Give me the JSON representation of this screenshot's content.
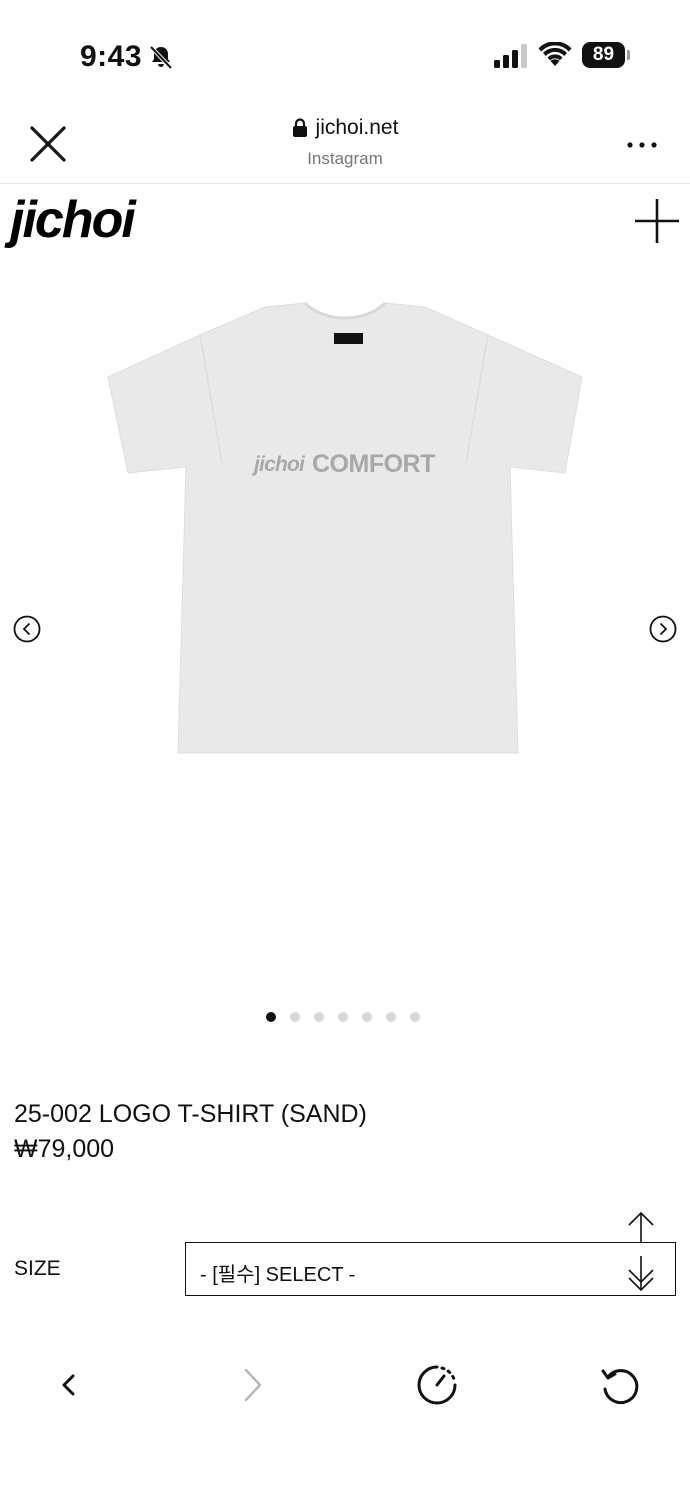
{
  "status_bar": {
    "time": "9:43",
    "battery": "89",
    "icons": [
      "bell-slash-icon",
      "cellular-signal-icon",
      "wifi-icon",
      "battery-icon"
    ]
  },
  "browser": {
    "url": "jichoi.net",
    "subtitle": "Instagram",
    "icons": [
      "close-icon",
      "lock-icon",
      "more-icon"
    ]
  },
  "site": {
    "logo": "jichoi",
    "menu_icon": "plus-icon"
  },
  "product": {
    "image_print_brand": "jichoi",
    "image_print_text": "COMFORT",
    "carousel_total": 7,
    "carousel_current": 1,
    "title": "25-002 LOGO T-SHIRT (SAND)",
    "price": "₩79,000"
  },
  "options": {
    "size_label": "SIZE",
    "size_select": "- [필수] SELECT -"
  },
  "toolbar": {
    "items": [
      "back-icon",
      "forward-icon",
      "speed-icon",
      "reload-icon"
    ]
  },
  "colors": {
    "shirt": "#e9e9e9",
    "print": "#a8a8a8",
    "dot_active": "#111111",
    "dot_inactive": "#d7d7d7"
  }
}
